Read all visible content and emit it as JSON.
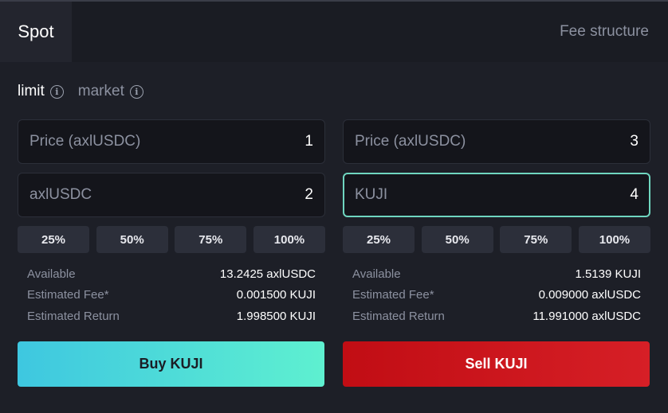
{
  "header": {
    "tab_spot": "Spot",
    "fee_structure": "Fee structure"
  },
  "order_types": [
    {
      "label": "limit",
      "active": true,
      "icon": "info-icon"
    },
    {
      "label": "market",
      "active": false,
      "icon": "info-icon"
    }
  ],
  "buy": {
    "price_label": "Price (axlUSDC)",
    "price_value": "1",
    "amount_label": "axlUSDC",
    "amount_value": "2",
    "pct": [
      "25%",
      "50%",
      "75%",
      "100%"
    ],
    "available_label": "Available",
    "available_value": "13.2425 axlUSDC",
    "fee_label": "Estimated Fee*",
    "fee_value": "0.001500 KUJI",
    "return_label": "Estimated Return",
    "return_value": "1.998500 KUJI",
    "button_label": "Buy KUJI"
  },
  "sell": {
    "price_label": "Price (axlUSDC)",
    "price_value": "3",
    "amount_label": "KUJI",
    "amount_value": "4",
    "pct": [
      "25%",
      "50%",
      "75%",
      "100%"
    ],
    "available_label": "Available",
    "available_value": "1.5139 KUJI",
    "fee_label": "Estimated Fee*",
    "fee_value": "0.009000 axlUSDC",
    "return_label": "Estimated Return",
    "return_value": "11.991000 axlUSDC",
    "button_label": "Sell KUJI"
  },
  "colors": {
    "background": "#1d1f27",
    "buy_gradient_start": "#3ec7e0",
    "buy_gradient_end": "#5ef0d0",
    "sell": "#c10d14",
    "focus_border": "#6fd6c0"
  }
}
